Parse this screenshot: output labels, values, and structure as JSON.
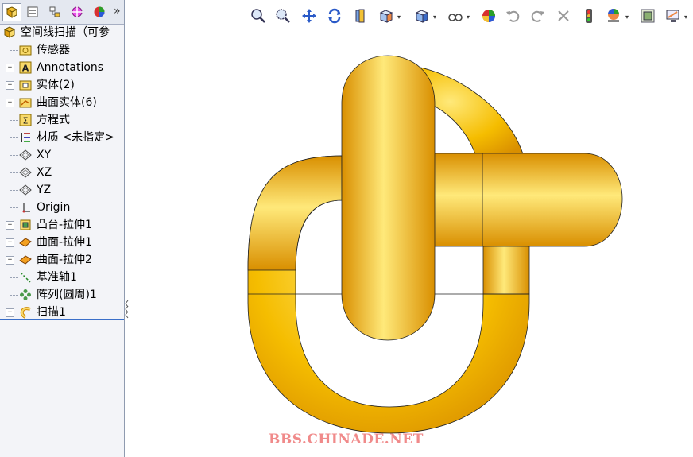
{
  "panel": {
    "tabs": [
      {
        "icon": "feature-manager-icon",
        "active": true
      },
      {
        "icon": "property-manager-icon"
      },
      {
        "icon": "configuration-manager-icon"
      },
      {
        "icon": "dimxpert-icon"
      },
      {
        "icon": "display-manager-icon"
      }
    ],
    "more": "»"
  },
  "tree": {
    "root": {
      "label": "空间线扫描（可参",
      "icon": "part-icon"
    },
    "items": [
      {
        "label": "传感器",
        "icon": "sensors-folder-icon",
        "expandable": false
      },
      {
        "label": "Annotations",
        "icon": "annotations-icon",
        "expandable": true
      },
      {
        "label": "实体(2)",
        "icon": "solid-bodies-icon",
        "expandable": true
      },
      {
        "label": "曲面实体(6)",
        "icon": "surface-bodies-icon",
        "expandable": true
      },
      {
        "label": "方程式",
        "icon": "equations-icon",
        "expandable": false
      },
      {
        "label": "材质 <未指定>",
        "icon": "material-icon",
        "expandable": false
      },
      {
        "label": "XY",
        "icon": "plane-icon",
        "expandable": false
      },
      {
        "label": "XZ",
        "icon": "plane-icon",
        "expandable": false
      },
      {
        "label": "YZ",
        "icon": "plane-icon",
        "expandable": false
      },
      {
        "label": "Origin",
        "icon": "origin-icon",
        "expandable": false
      },
      {
        "label": "凸台-拉伸1",
        "icon": "boss-extrude-icon",
        "expandable": true
      },
      {
        "label": "曲面-拉伸1",
        "icon": "surface-extrude-icon",
        "expandable": true
      },
      {
        "label": "曲面-拉伸2",
        "icon": "surface-extrude-icon",
        "expandable": true
      },
      {
        "label": "基准轴1",
        "icon": "axis-icon",
        "expandable": false
      },
      {
        "label": "阵列(圆周)1",
        "icon": "circular-pattern-icon",
        "expandable": false
      },
      {
        "label": "扫描1",
        "icon": "sweep-icon",
        "expandable": true
      }
    ]
  },
  "toolbar": {
    "buttons": [
      {
        "icon": "zoom-to-fit-icon"
      },
      {
        "icon": "zoom-to-area-icon"
      },
      {
        "icon": "pan-icon"
      },
      {
        "icon": "rotate-icon"
      },
      {
        "icon": "section-view-icon"
      },
      {
        "icon": "view-orientation-icon",
        "dropdown": true
      },
      {
        "icon": "display-style-icon",
        "dropdown": true
      },
      {
        "icon": "hide-show-items-icon",
        "dropdown": true
      },
      {
        "icon": "edit-appearance-icon"
      },
      {
        "icon": "undo-icon"
      },
      {
        "icon": "redo-icon"
      },
      {
        "icon": "close-icon"
      },
      {
        "icon": "traffic-light-icon"
      },
      {
        "icon": "apply-scene-icon",
        "dropdown": true
      },
      {
        "icon": "view-settings-icon"
      },
      {
        "icon": "display-pane-icon",
        "dropdown": true
      }
    ]
  },
  "model": {
    "color": "#f5bd00",
    "shade": "#d98f00",
    "highlight": "#ffe97a"
  },
  "watermark": "BBS.CHINADE.NET"
}
